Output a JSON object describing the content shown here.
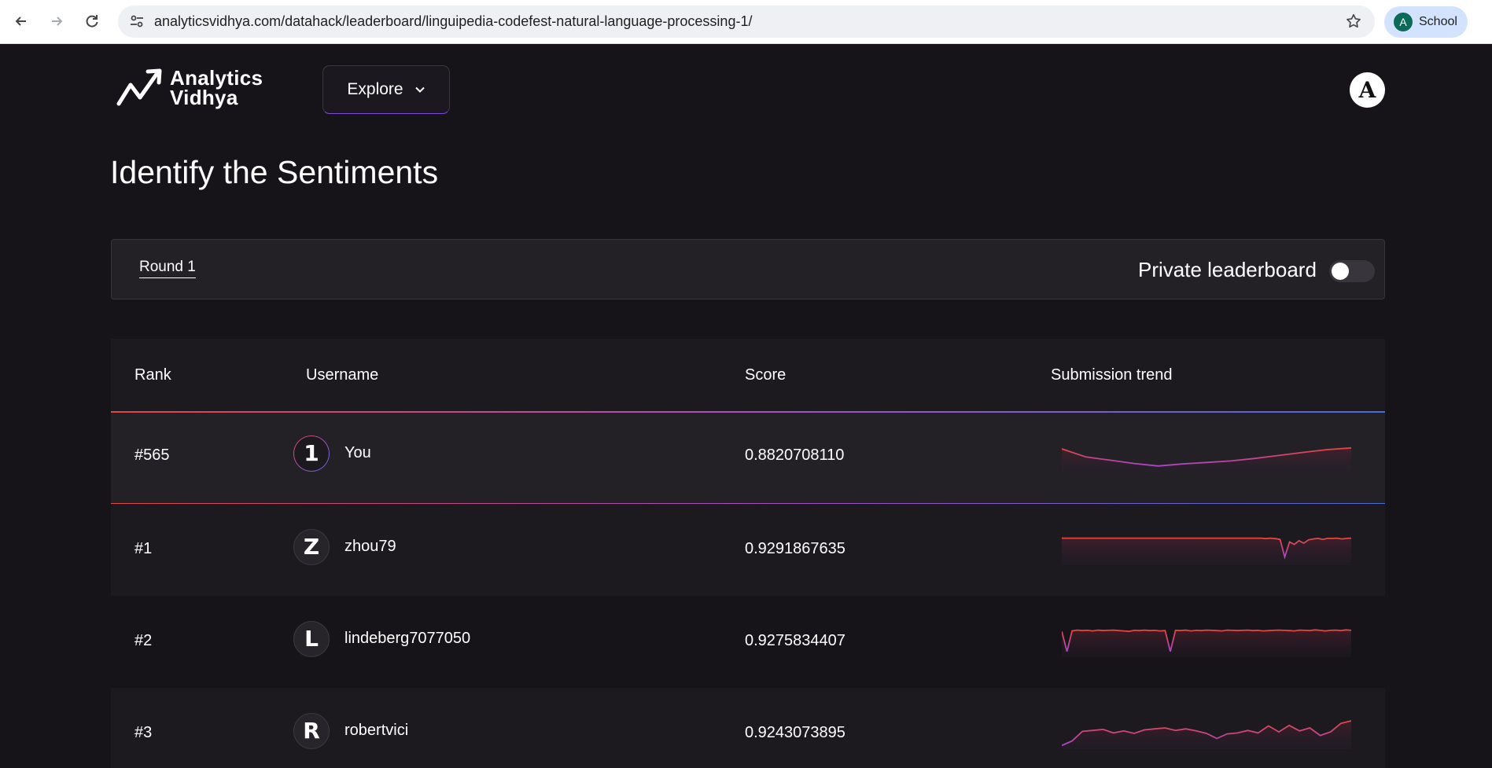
{
  "browser": {
    "url": "analyticsvidhya.com/datahack/leaderboard/linguipedia-codefest-natural-language-processing-1/",
    "profile_initial": "A",
    "profile_label": "School"
  },
  "header": {
    "logo_line1": "Analytics",
    "logo_line2": "Vidhya",
    "explore_label": "Explore",
    "user_initial": "A"
  },
  "page": {
    "title": "Identify the Sentiments"
  },
  "round_bar": {
    "round_tab": "Round 1",
    "private_label": "Private leaderboard",
    "private_enabled": false
  },
  "table": {
    "columns": [
      "Rank",
      "Username",
      "Score",
      "Submission trend"
    ],
    "rows": [
      {
        "rank": "#565",
        "initial": "1",
        "username": "You",
        "score": "0.8820708110",
        "trend": [
          0.78,
          0.46,
          0.33,
          0.2,
          0.1,
          0.18,
          0.24,
          0.3,
          0.4,
          0.52,
          0.64,
          0.75,
          0.82
        ]
      },
      {
        "rank": "#1",
        "initial": "Z",
        "username": "zhou79",
        "score": "0.9291867635",
        "trend": [
          0.95,
          0.95,
          0.95,
          0.95,
          0.95,
          0.95,
          0.95,
          0.95,
          0.95,
          0.95,
          0.95,
          0.95,
          0.95,
          0.95,
          0.95,
          0.95,
          0.95,
          0.95,
          0.95,
          0.95,
          0.95,
          0.95,
          0.95,
          0.95,
          0.95,
          0.95,
          0.95,
          0.95,
          0.95,
          0.95,
          0.95,
          0.95,
          0.95,
          0.95,
          0.95,
          0.95,
          0.95,
          0.95,
          0.95,
          0.95,
          0.95,
          0.95,
          0.95,
          0.93,
          0.95,
          0.93,
          0.9,
          0.2,
          0.8,
          0.7,
          0.85,
          0.75,
          0.88,
          0.92,
          0.94,
          0.9,
          0.94,
          0.94,
          0.95,
          0.92,
          0.94,
          0.95
        ]
      },
      {
        "rank": "#2",
        "initial": "L",
        "username": "lindeberg7077050",
        "score": "0.9275834407",
        "trend": [
          0.9,
          0.1,
          0.92,
          0.95,
          0.93,
          0.94,
          0.92,
          0.95,
          0.93,
          0.94,
          0.95,
          0.93,
          0.92,
          0.9,
          0.94,
          0.93,
          0.95,
          0.93,
          0.94,
          0.92,
          0.93,
          0.1,
          0.94,
          0.93,
          0.95,
          0.92,
          0.94,
          0.93,
          0.95,
          0.94,
          0.93,
          0.92,
          0.95,
          0.94,
          0.93,
          0.94,
          0.95,
          0.93,
          0.94,
          0.92,
          0.93,
          0.94,
          0.95,
          0.94,
          0.93,
          0.92,
          0.95,
          0.94,
          0.93,
          0.96,
          0.94,
          0.92,
          0.94,
          0.95,
          0.93,
          0.96,
          0.94
        ]
      },
      {
        "rank": "#3",
        "initial": "R",
        "username": "robertvici",
        "score": "0.9243073895",
        "trend": [
          0.02,
          0.2,
          0.58,
          0.62,
          0.66,
          0.52,
          0.6,
          0.5,
          0.64,
          0.68,
          0.72,
          0.62,
          0.68,
          0.6,
          0.5,
          0.3,
          0.48,
          0.52,
          0.62,
          0.52,
          0.8,
          0.56,
          0.82,
          0.6,
          0.72,
          0.42,
          0.56,
          0.9,
          1.0
        ]
      }
    ]
  }
}
